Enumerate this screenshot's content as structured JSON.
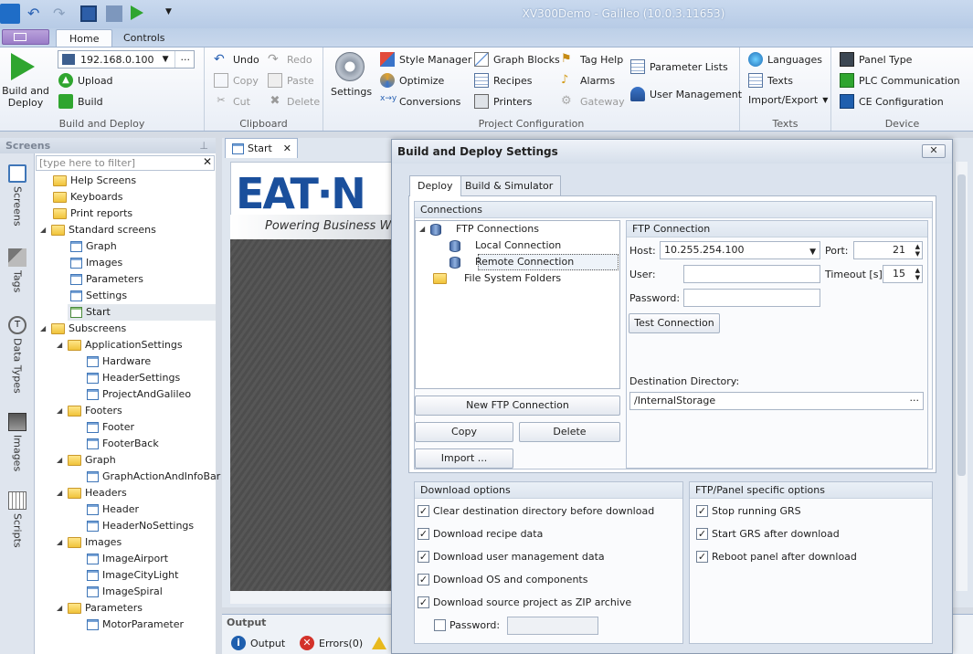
{
  "window": {
    "title": "XV300Demo - Galileo (10.0.3.11653)"
  },
  "ribbon_tabs": [
    {
      "label": "Home"
    },
    {
      "label": "Controls"
    }
  ],
  "ribbon": {
    "build": {
      "big_label_1": "Build and",
      "big_label_2": "Deploy",
      "target": "192.168.0.100",
      "upload": "Upload",
      "build": "Build",
      "group": "Build and Deploy"
    },
    "clipboard": {
      "undo": "Undo",
      "redo": "Redo",
      "copy": "Copy",
      "paste": "Paste",
      "cut": "Cut",
      "delete": "Delete",
      "group": "Clipboard"
    },
    "project": {
      "settings": "Settings",
      "style_manager": "Style Manager",
      "optimize": "Optimize",
      "conversions": "Conversions",
      "graph_blocks": "Graph Blocks",
      "recipes": "Recipes",
      "printers": "Printers",
      "tag_help": "Tag Help",
      "alarms": "Alarms",
      "gateway": "Gateway",
      "parameter_lists": "Parameter Lists",
      "user_management": "User Management",
      "group": "Project Configuration"
    },
    "texts": {
      "languages": "Languages",
      "texts": "Texts",
      "import_export": "Import/Export",
      "group": "Texts"
    },
    "device": {
      "panel_type": "Panel Type",
      "plc_comm": "PLC Communication",
      "ce_config": "CE Configuration",
      "group": "Device"
    }
  },
  "screens_panel": {
    "title": "Screens",
    "filter_placeholder": "[type here to filter]",
    "side_tabs": [
      "Screens",
      "Tags",
      "Data Types",
      "Images",
      "Scripts"
    ],
    "tree": [
      {
        "label": "Help Screens"
      },
      {
        "label": "Keyboards"
      },
      {
        "label": "Print reports"
      },
      {
        "label": "Standard screens"
      },
      {
        "label": "Graph"
      },
      {
        "label": "Images"
      },
      {
        "label": "Parameters"
      },
      {
        "label": "Settings"
      },
      {
        "label": "Start"
      },
      {
        "label": "Subscreens"
      },
      {
        "label": "ApplicationSettings"
      },
      {
        "label": "Hardware"
      },
      {
        "label": "HeaderSettings"
      },
      {
        "label": "ProjectAndGalileo"
      },
      {
        "label": "Footers"
      },
      {
        "label": "Footer"
      },
      {
        "label": "FooterBack"
      },
      {
        "label": "Graph"
      },
      {
        "label": "GraphActionAndInfoBar"
      },
      {
        "label": "Headers"
      },
      {
        "label": "Header"
      },
      {
        "label": "HeaderNoSettings"
      },
      {
        "label": "Images"
      },
      {
        "label": "ImageAirport"
      },
      {
        "label": "ImageCityLight"
      },
      {
        "label": "ImageSpiral"
      },
      {
        "label": "Parameters"
      },
      {
        "label": "MotorParameter"
      }
    ]
  },
  "document": {
    "tab": "Start",
    "logo": "EAT·N",
    "tagline": "Powering Business Worl"
  },
  "output": {
    "title": "Output",
    "tab_output": "Output",
    "tab_errors": "Errors(0)"
  },
  "dialog": {
    "title": "Build and Deploy Settings",
    "close": "✕",
    "tabs": [
      {
        "label": "Deploy"
      },
      {
        "label": "Build & Simulator"
      }
    ],
    "connections_header": "Connections",
    "conn_tree": {
      "root": "FTP Connections",
      "local": "Local Connection",
      "remote": "Remote Connection",
      "fs": "File System Folders"
    },
    "buttons": {
      "new_ftp": "New FTP Connection",
      "copy": "Copy",
      "delete": "Delete",
      "import": "Import ...",
      "test": "Test Connection"
    },
    "ftp": {
      "header": "FTP Connection",
      "host_label": "Host:",
      "host_value": "10.255.254.100",
      "port_label": "Port:",
      "port_value": "21",
      "user_label": "User:",
      "user_value": "",
      "timeout_label": "Timeout [s]:",
      "timeout_value": "15",
      "password_label": "Password:",
      "password_value": "",
      "dest_label": "Destination Directory:",
      "dest_value": "/InternalStorage",
      "dest_browse": "···"
    },
    "download": {
      "header": "Download options",
      "options": [
        {
          "label": "Clear destination directory before download",
          "checked": true
        },
        {
          "label": "Download recipe data",
          "checked": true
        },
        {
          "label": "Download user management data",
          "checked": true
        },
        {
          "label": "Download OS and components",
          "checked": true
        },
        {
          "label": "Download source project as ZIP archive",
          "checked": true
        }
      ],
      "password_label": "Password:",
      "password_checked": false
    },
    "panel_opts": {
      "header": "FTP/Panel specific options",
      "options": [
        {
          "label": "Stop running GRS",
          "checked": true
        },
        {
          "label": "Start GRS after download",
          "checked": true
        },
        {
          "label": "Reboot panel after download",
          "checked": true
        }
      ]
    }
  },
  "colors": {
    "accent": "#3f76b8",
    "brand": "#1a4f9c",
    "run_green": "#2fa52f"
  }
}
